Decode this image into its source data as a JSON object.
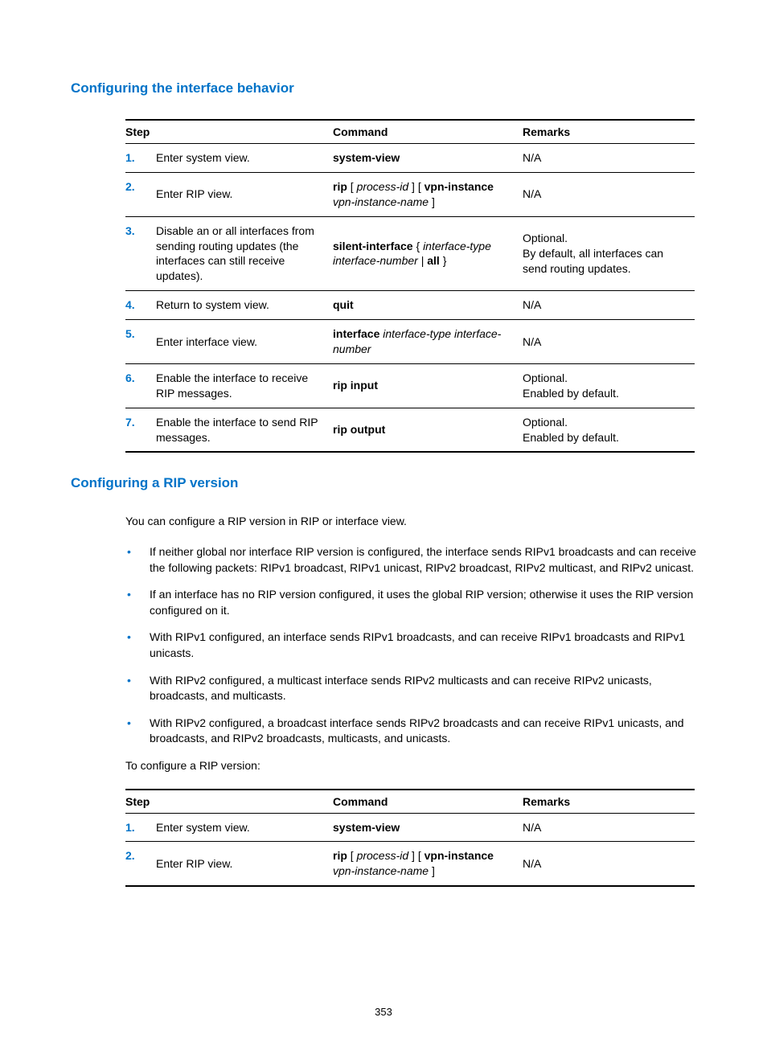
{
  "page_number": "353",
  "section1": {
    "title": "Configuring the interface behavior",
    "table": {
      "headers": {
        "step": "Step",
        "command": "Command",
        "remarks": "Remarks"
      },
      "rows": [
        {
          "num": "1.",
          "step": "Enter system view.",
          "cmd_segments": [
            {
              "text": "system-view",
              "style": "bold"
            }
          ],
          "remarks": [
            "N/A"
          ]
        },
        {
          "num": "2.",
          "step": "Enter RIP view.",
          "cmd_segments": [
            {
              "text": "rip",
              "style": "bold"
            },
            {
              "text": " [ ",
              "style": ""
            },
            {
              "text": "process-id",
              "style": "ital"
            },
            {
              "text": " ] [ ",
              "style": ""
            },
            {
              "text": "vpn-instance",
              "style": "bold"
            },
            {
              "text": " ",
              "style": ""
            },
            {
              "text": "vpn-instance-name",
              "style": "ital"
            },
            {
              "text": " ]",
              "style": ""
            }
          ],
          "remarks": [
            "N/A"
          ]
        },
        {
          "num": "3.",
          "step": "Disable an or all interfaces from sending routing updates (the interfaces can still receive updates).",
          "cmd_segments": [
            {
              "text": "silent-interface",
              "style": "bold"
            },
            {
              "text": " { ",
              "style": ""
            },
            {
              "text": "interface-type interface-number",
              "style": "ital"
            },
            {
              "text": " | ",
              "style": ""
            },
            {
              "text": "all",
              "style": "bold"
            },
            {
              "text": " }",
              "style": ""
            }
          ],
          "remarks": [
            "Optional.",
            "By default, all interfaces can send routing updates."
          ]
        },
        {
          "num": "4.",
          "step": "Return to system view.",
          "cmd_segments": [
            {
              "text": "quit",
              "style": "bold"
            }
          ],
          "remarks": [
            "N/A"
          ]
        },
        {
          "num": "5.",
          "step": "Enter interface view.",
          "cmd_segments": [
            {
              "text": "interface",
              "style": "bold"
            },
            {
              "text": " ",
              "style": ""
            },
            {
              "text": "interface-type interface-number",
              "style": "ital"
            }
          ],
          "remarks": [
            "N/A"
          ]
        },
        {
          "num": "6.",
          "step": "Enable the interface to receive RIP messages.",
          "cmd_segments": [
            {
              "text": "rip input",
              "style": "bold"
            }
          ],
          "remarks": [
            "Optional.",
            "Enabled by default."
          ]
        },
        {
          "num": "7.",
          "step": "Enable the interface to send RIP messages.",
          "cmd_segments": [
            {
              "text": "rip output",
              "style": "bold"
            }
          ],
          "remarks": [
            "Optional.",
            "Enabled by default."
          ]
        }
      ]
    }
  },
  "section2": {
    "title": "Configuring a RIP version",
    "intro": "You can configure a RIP version in RIP or interface view.",
    "bullets": [
      "If neither global nor interface RIP version is configured, the interface sends RIPv1 broadcasts and can receive the following packets: RIPv1 broadcast, RIPv1 unicast, RIPv2 broadcast, RIPv2 multicast, and RIPv2 unicast.",
      "If an interface has no RIP version configured, it uses the global RIP version; otherwise it uses the RIP version configured on it.",
      "With RIPv1 configured, an interface sends RIPv1 broadcasts, and can receive RIPv1 broadcasts and RIPv1 unicasts.",
      "With RIPv2 configured, a multicast interface sends RIPv2 multicasts and can receive RIPv2 unicasts, broadcasts, and multicasts.",
      "With RIPv2 configured, a broadcast interface sends RIPv2 broadcasts and can receive RIPv1 unicasts, and broadcasts, and RIPv2 broadcasts, multicasts, and unicasts."
    ],
    "lead_out": "To configure a RIP version:",
    "table": {
      "headers": {
        "step": "Step",
        "command": "Command",
        "remarks": "Remarks"
      },
      "rows": [
        {
          "num": "1.",
          "step": "Enter system view.",
          "cmd_segments": [
            {
              "text": "system-view",
              "style": "bold"
            }
          ],
          "remarks": [
            "N/A"
          ]
        },
        {
          "num": "2.",
          "step": "Enter RIP view.",
          "cmd_segments": [
            {
              "text": "rip",
              "style": "bold"
            },
            {
              "text": " [ ",
              "style": ""
            },
            {
              "text": "process-id",
              "style": "ital"
            },
            {
              "text": " ] [ ",
              "style": ""
            },
            {
              "text": "vpn-instance",
              "style": "bold"
            },
            {
              "text": " ",
              "style": ""
            },
            {
              "text": "vpn-instance-name",
              "style": "ital"
            },
            {
              "text": " ]",
              "style": ""
            }
          ],
          "remarks": [
            "N/A"
          ]
        }
      ]
    }
  }
}
